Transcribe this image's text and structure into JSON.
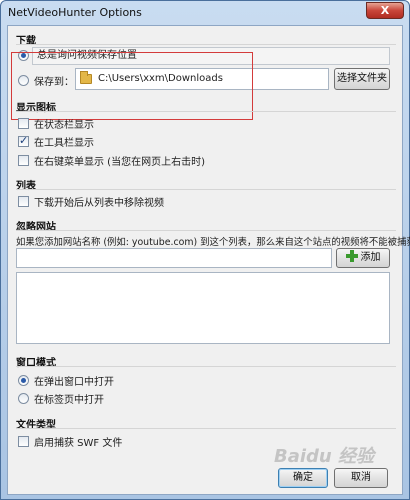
{
  "window": {
    "title": "NetVideoHunter Options",
    "close_label": "X"
  },
  "download": {
    "title": "下载",
    "always_ask_label": "总是询问视频保存位置",
    "save_to_label": "保存到：",
    "path": "C:\\Users\\xxm\\Downloads",
    "choose_folder_label": "选择文件夹",
    "selected": "always_ask"
  },
  "display_icon": {
    "title": "显示图标",
    "items": [
      {
        "label": "在状态栏显示",
        "checked": false
      },
      {
        "label": "在工具栏显示",
        "checked": true
      },
      {
        "label": "在右键菜单显示 (当您在网页上右击时)",
        "checked": false
      }
    ]
  },
  "list": {
    "title": "列表",
    "remove_on_start_label": "下载开始后从列表中移除视频",
    "checked": false
  },
  "ignore_sites": {
    "title": "忽略网站",
    "description": "如果您添加网站名称 (例如: youtube.com) 到这个列表，那么来自这个站点的视频将不能被捕获.",
    "input_value": "",
    "add_label": "添加"
  },
  "window_mode": {
    "title": "窗口模式",
    "popup_label": "在弹出窗口中打开",
    "tab_label": "在标签页中打开",
    "selected": "popup"
  },
  "file_type": {
    "title": "文件类型",
    "enable_swf_label": "启用捕获 SWF 文件",
    "checked": false
  },
  "footer": {
    "ok_label": "确定",
    "cancel_label": "取消"
  },
  "watermark_text": "Baidu 经验",
  "colors": {
    "highlight_box": "#d33b3b",
    "titlebar": "#c9dcf1",
    "client_bg": "#f0f0f0"
  }
}
